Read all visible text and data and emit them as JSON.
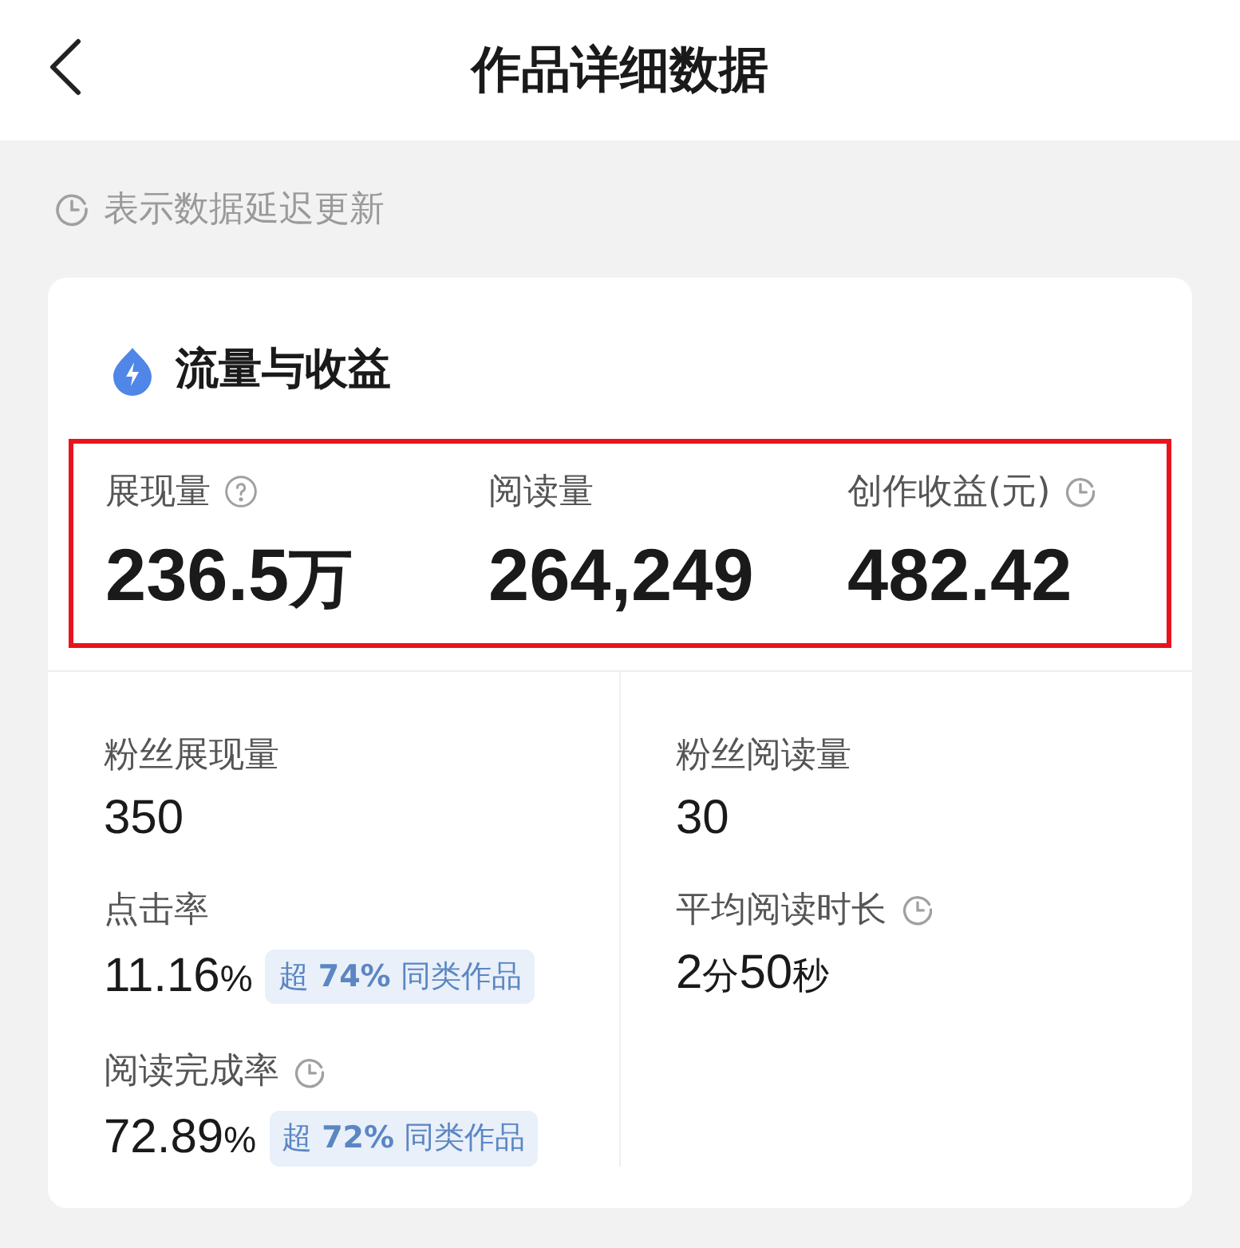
{
  "header": {
    "title": "作品详细数据"
  },
  "notice": {
    "text": "表示数据延迟更新"
  },
  "card": {
    "title": "流量与收益",
    "highlight": [
      {
        "label": "展现量",
        "kind": "help",
        "value": [
          {
            "text": "236.5",
            "kind": "number"
          },
          {
            "text": "万",
            "kind": "unit"
          }
        ]
      },
      {
        "label": "阅读量",
        "value": [
          {
            "text": "264,249",
            "kind": "number"
          }
        ]
      },
      {
        "label": "创作收益(元)",
        "kind": "delayed",
        "value": [
          {
            "text": "482.42",
            "kind": "number"
          }
        ]
      }
    ],
    "columns": [
      [
        {
          "label": "粉丝展现量",
          "value": [
            {
              "text": "350",
              "kind": "number"
            }
          ]
        },
        {
          "label": "点击率",
          "value": [
            {
              "text": "11.16",
              "kind": "number"
            },
            {
              "text": "%",
              "kind": "unit"
            }
          ],
          "badge": "超 **74%** 同类作品"
        },
        {
          "label": "阅读完成率",
          "kind": "delayed",
          "value": [
            {
              "text": "72.89",
              "kind": "number"
            },
            {
              "text": "%",
              "kind": "unit"
            }
          ],
          "badge": "超 **72%** 同类作品"
        }
      ],
      [
        {
          "label": "粉丝阅读量",
          "value": [
            {
              "text": "30",
              "kind": "number"
            }
          ]
        },
        {
          "label": "平均阅读时长",
          "kind": "delayed",
          "value": [
            {
              "text": "2",
              "kind": "number"
            },
            {
              "text": "分",
              "kind": "unit"
            },
            {
              "text": "50",
              "kind": "number"
            },
            {
              "text": "秒",
              "kind": "unit"
            }
          ]
        }
      ]
    ]
  }
}
